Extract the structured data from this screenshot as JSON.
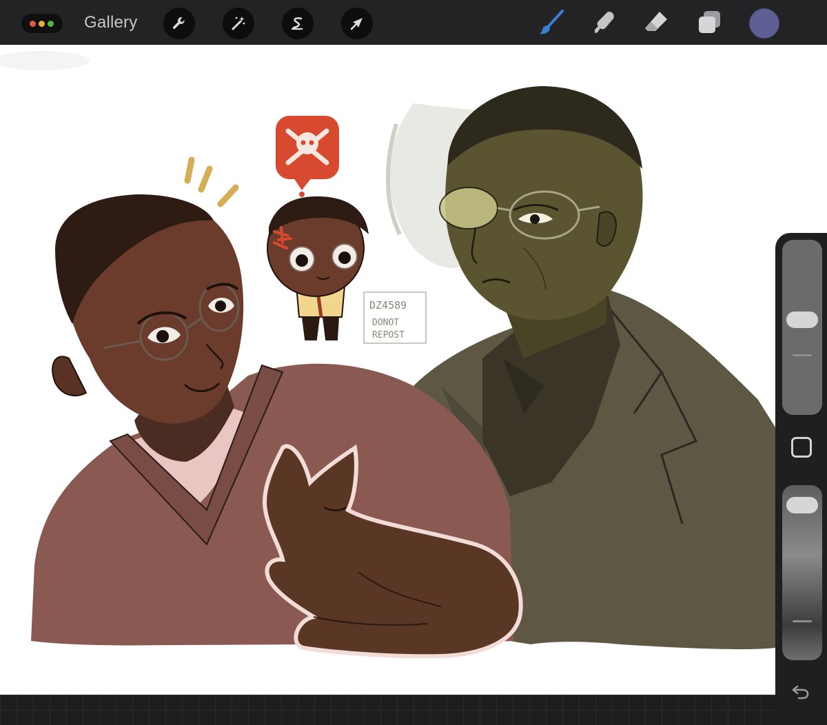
{
  "toolbar": {
    "gallery_label": "Gallery",
    "tools_left": [
      "wrench-icon",
      "magic-wand-icon",
      "selection-s-icon",
      "transform-arrow-icon"
    ],
    "tools_right": [
      "brush-icon",
      "smudge-icon",
      "eraser-icon",
      "layers-icon"
    ],
    "brush_accent_color": "#3a7fd6",
    "current_color": "#5e6095"
  },
  "canvas": {
    "watermark": {
      "line1": "DZ4589",
      "line2": "DONOT",
      "line3": "REPOST"
    }
  },
  "sidebar": {
    "brush_size_level": 0.55,
    "opacity_level": 0.95
  }
}
